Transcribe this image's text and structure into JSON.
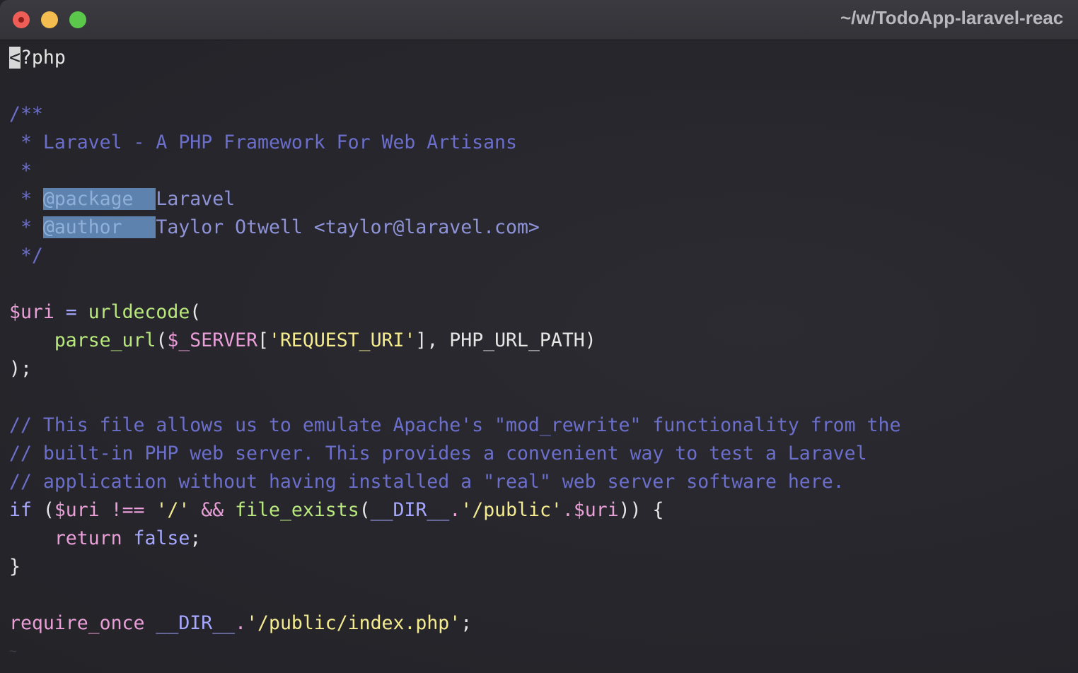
{
  "window": {
    "title": "~/w/TodoApp-laravel-reac",
    "colors": {
      "background": "#25252b",
      "comment": "#6b6fcb",
      "function": "#b9e97c",
      "string": "#f5ec90",
      "variable": "#ea9fd8",
      "tag_highlight": "#5c82ad"
    }
  },
  "code": {
    "line1_cursor": "<",
    "line1_rest": "?php",
    "doc_open": "/**",
    "doc_title": " * Laravel - A PHP Framework For Web Artisans",
    "doc_star": " *",
    "doc_star_prefix": " * ",
    "tag_package": "@package  ",
    "tag_package_value": "Laravel",
    "tag_author": "@author   ",
    "tag_author_value": "Taylor Otwell <taylor@laravel.com>",
    "doc_close": " */",
    "uri_var": "$uri",
    "uri_eq": " = ",
    "uri_func": "urldecode",
    "uri_paren": "(",
    "parse_indent": "    ",
    "parse_func": "parse_url",
    "parse_open": "(",
    "server_var": "$_SERVER",
    "server_bracket": "[",
    "request_uri": "'REQUEST_URI'",
    "parse_rest": "], PHP_URL_PATH)",
    "close_stmt": ");",
    "comment1": "// This file allows us to emulate Apache's \"mod_rewrite\" functionality from the",
    "comment2": "// built-in PHP web server. This provides a convenient way to test a Laravel",
    "comment3": "// application without having installed a \"real\" web server software here.",
    "if_kw": "if",
    "if_open": " (",
    "if_var": "$uri",
    "if_op": " !== ",
    "if_slash": "'/'",
    "if_and": " && ",
    "if_func": "file_exists",
    "if_paren": "(",
    "if_dir": "__DIR__",
    "if_dot": ".",
    "if_public": "'/public'",
    "if_dot2": ".",
    "if_var2": "$uri",
    "if_close": ")) {",
    "return_indent": "    ",
    "return_kw": "return",
    "return_space": " ",
    "return_false": "false",
    "return_semi": ";",
    "brace_close": "}",
    "require_kw": "require_once",
    "require_space": " ",
    "require_dir": "__DIR__",
    "require_dot": ".",
    "require_path": "'/public/index.php'",
    "require_semi": ";",
    "tilde": "~"
  }
}
